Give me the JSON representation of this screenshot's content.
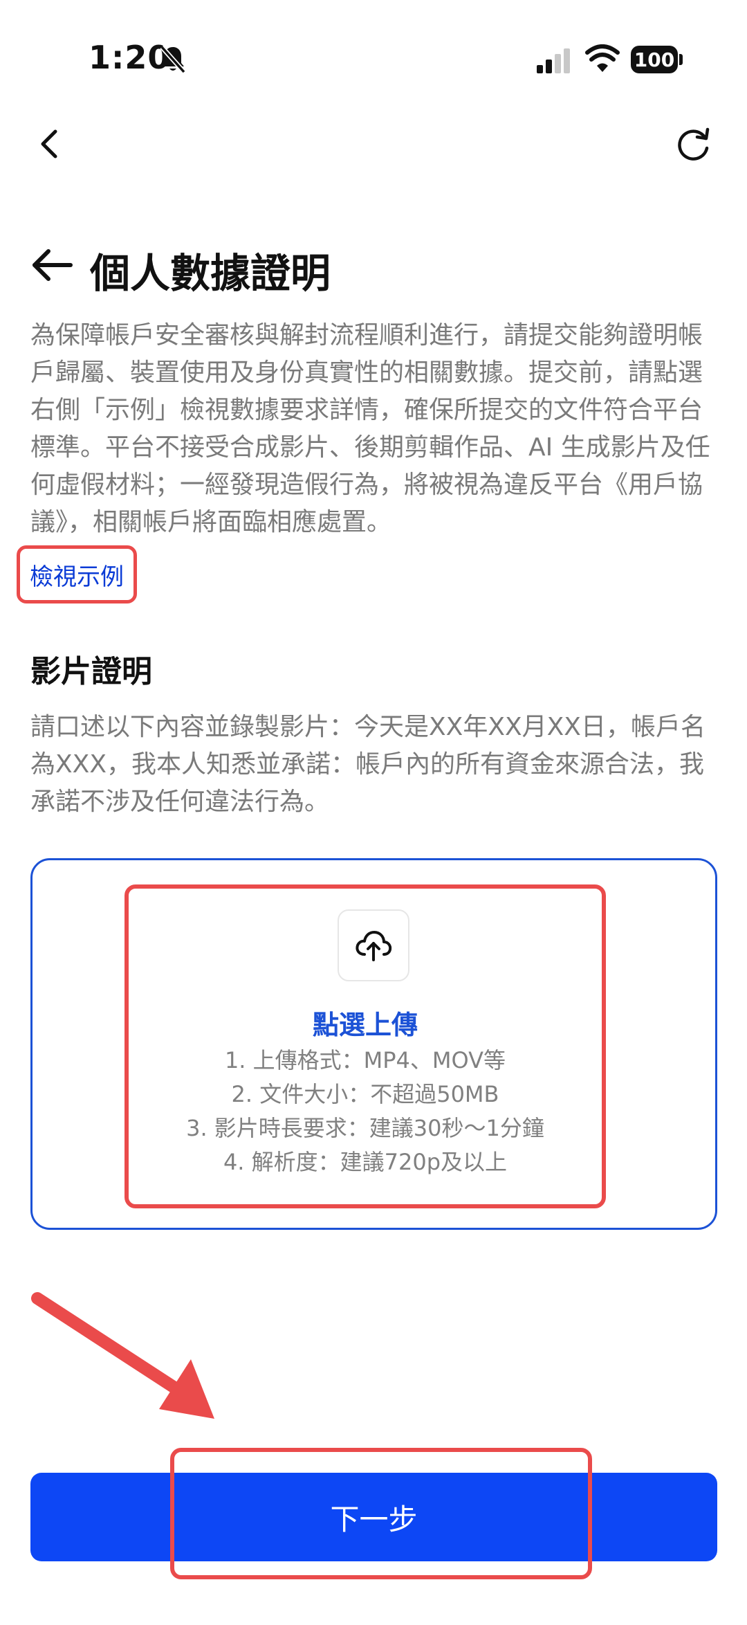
{
  "status_bar": {
    "time": "1:20",
    "battery": "100"
  },
  "title": "個人數據證明",
  "intro": "為保障帳戶安全審核與解封流程順利進行，請提交能夠證明帳戶歸屬、裝置使用及身份真實性的相關數據。提交前，請點選右側「示例」檢視數據要求詳情，確保所提交的文件符合平台標準。平台不接受合成影片、後期剪輯作品、AI 生成影片及任何虛假材料；一經發現造假行為，將被視為違反平台《用戶協議》，相關帳戶將面臨相應處置。",
  "view_example_link": "檢視示例",
  "video_section": {
    "title": "影片證明",
    "description": "請口述以下內容並錄製影片：今天是XX年XX月XX日，帳戶名為XXX，我本人知悉並承諾：帳戶內的所有資金來源合法，我承諾不涉及任何違法行為。"
  },
  "upload": {
    "title": "點選上傳",
    "requirements": [
      "1. 上傳格式：MP4、MOV等",
      "2. 文件大小：不超過50MB",
      "3. 影片時長要求：建議30秒～1分鐘",
      "4. 解析度：建議720p及以上"
    ]
  },
  "next_button": "下一步",
  "colors": {
    "accent": "#0d47f5",
    "link": "#0a3bd6",
    "highlight": "#ea4b4b",
    "muted_text": "#7a7a7a"
  },
  "icons": [
    "bell-slash-icon",
    "signal-icon",
    "wifi-icon",
    "chevron-left-icon",
    "refresh-icon",
    "arrow-left-icon",
    "cloud-upload-icon",
    "annotation-arrow-icon"
  ]
}
